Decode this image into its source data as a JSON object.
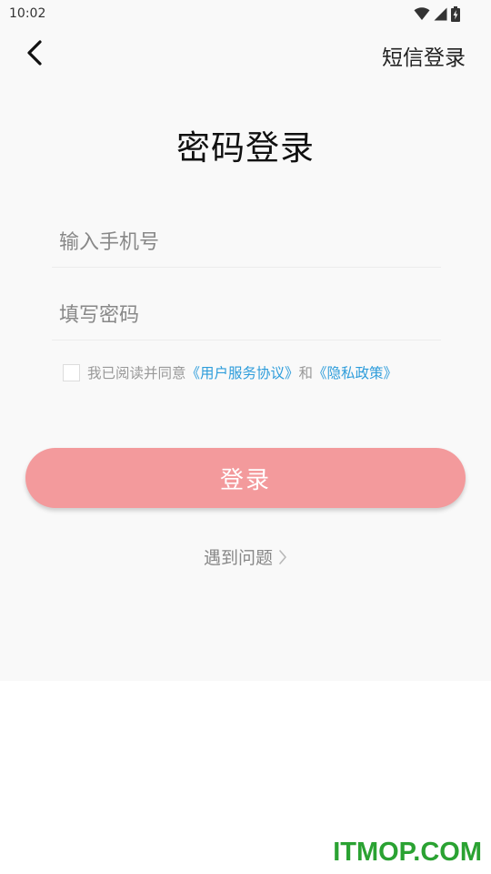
{
  "status_bar": {
    "time": "10:02",
    "icons": [
      "wifi-icon",
      "cell-signal-icon",
      "battery-icon"
    ]
  },
  "nav": {
    "back_icon": "chevron-left-icon",
    "right_action_label": "短信登录"
  },
  "title": "密码登录",
  "form": {
    "phone": {
      "placeholder": "输入手机号",
      "value": ""
    },
    "password": {
      "placeholder": "填写密码",
      "value": ""
    }
  },
  "agreement": {
    "checked": false,
    "prefix": "我已阅读并同意",
    "user_agreement_link": "《用户服务协议》",
    "conjunction": "和",
    "privacy_link": "《隐私政策》"
  },
  "login_button_label": "登录",
  "help_link": {
    "label": "遇到问题",
    "icon": "chevron-right-icon"
  },
  "watermark": "ITMOP.COM",
  "colors": {
    "primary_button": "#f39a9c",
    "link": "#2e9ddb",
    "watermark": "#2aa232",
    "screen_background": "#f9f9f9"
  }
}
